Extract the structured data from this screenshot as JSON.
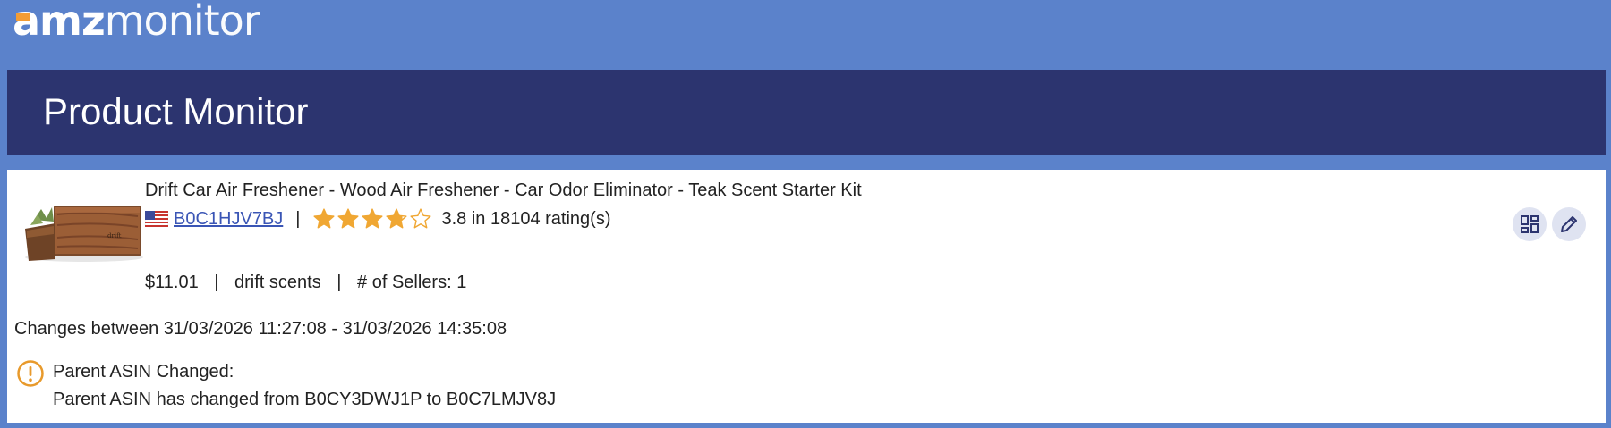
{
  "brand": {
    "logo_bold": "amz",
    "logo_thin": "monitor",
    "accent_color": "#f39c34"
  },
  "header": {
    "title": "Product Monitor",
    "band_color": "#2c346f",
    "background_color": "#5b82cb"
  },
  "product": {
    "title": "Drift Car Air Freshener - Wood Air Freshener - Car Odor Eliminator - Teak Scent Starter Kit",
    "marketplace_flag_icon": "us-flag-icon",
    "asin": "B0C1HJV7BJ",
    "separator": "|",
    "rating": 3.8,
    "rating_max": 5,
    "rating_text": "3.8 in 18104 rating(s)",
    "star_color": "#f0a733",
    "price": "$11.01",
    "brand": "drift scents",
    "sellers": "# of Sellers: 1",
    "thumbnail_icon": "product-thumbnail"
  },
  "actions": {
    "layout_icon": "dashboard-icon",
    "edit_icon": "pencil-icon"
  },
  "changes": {
    "range_text": "Changes between 31/03/2026 11:27:08 - 31/03/2026 14:35:08",
    "alert_icon": "warning-circle-icon",
    "alert_color": "#e89a2c",
    "alert_title": "Parent ASIN Changed:",
    "alert_body": "Parent ASIN has changed from B0CY3DWJ1P to B0C7LMJV8J"
  }
}
